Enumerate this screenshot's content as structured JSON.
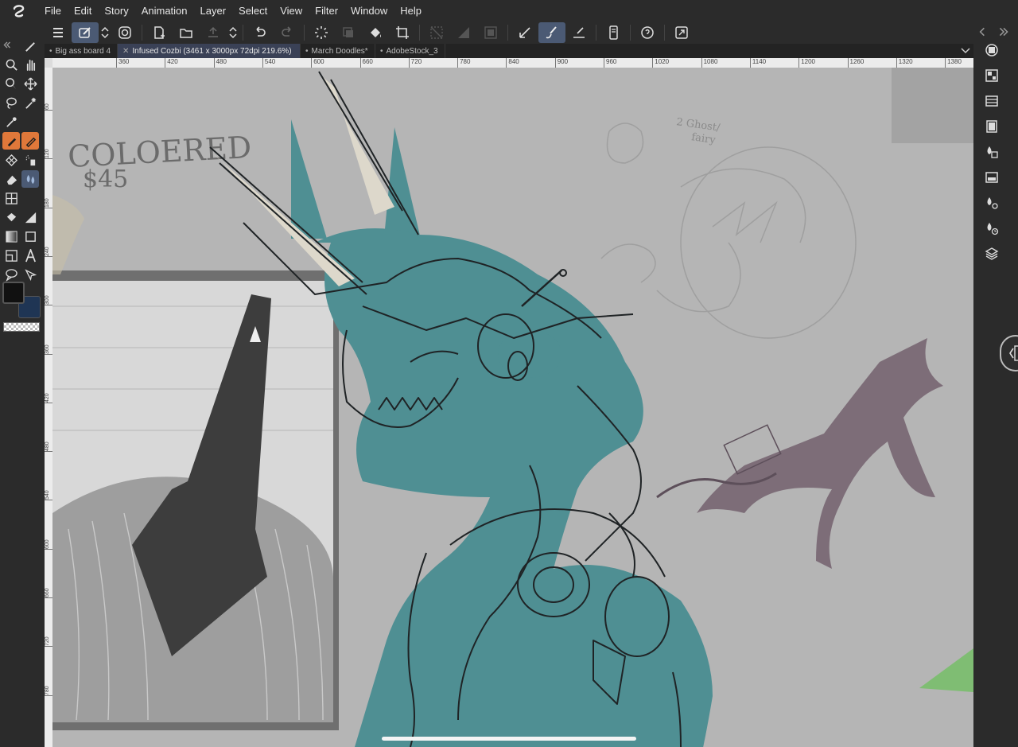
{
  "menu": {
    "items": [
      "File",
      "Edit",
      "Story",
      "Animation",
      "Layer",
      "Select",
      "View",
      "Filter",
      "Window",
      "Help"
    ]
  },
  "commandbar": {
    "buttons": [
      "menu-icon",
      "edit-mode-icon",
      "updown-icon",
      "spiral-icon",
      "new-doc-icon",
      "open-icon",
      "save-icon",
      "updown-icon",
      "undo-icon",
      "redo-icon",
      "spinner-icon",
      "transform-icon",
      "fill-icon",
      "crop-icon",
      "clear-outside-icon",
      "clear-icon",
      "invert-icon",
      "ruler-snap-icon",
      "brush-snap-icon",
      "line-snap-icon",
      "device-icon",
      "help-icon",
      "expand-icon"
    ]
  },
  "tabs": [
    {
      "label": "Big ass board 4",
      "mark": "•",
      "active": false
    },
    {
      "label": "Infused Cozbi (3461 x 3000px 72dpi 219.6%)",
      "mark": "✕",
      "active": true
    },
    {
      "label": "March Doodles*",
      "mark": "•",
      "active": false
    },
    {
      "label": "AdobeStock_3",
      "mark": "•",
      "active": false
    }
  ],
  "ruler": {
    "top_ticks": [
      "360",
      "420",
      "480",
      "540",
      "600",
      "660",
      "720",
      "780",
      "840",
      "900",
      "960",
      "1020",
      "1080",
      "1140",
      "1200",
      "1260",
      "1320",
      "1380"
    ],
    "left_ticks": [
      "60",
      "120",
      "180",
      "240",
      "300",
      "360",
      "420",
      "480",
      "540",
      "600",
      "660",
      "720",
      "780"
    ]
  },
  "canvas": {
    "note_main": "COLOERED",
    "note_price": "$45",
    "note_sketch": "2 Ghost/",
    "note_sketch_2": "fairy"
  },
  "colors": {
    "chrome": "#2b2b2b",
    "accent_orange": "#e0783a",
    "accent_blue": "#4b5a74",
    "canvas_bg": "#b5b5b5",
    "teal": "#4f8f93",
    "main_color": "#111111",
    "sub_color": "#1f3554"
  }
}
